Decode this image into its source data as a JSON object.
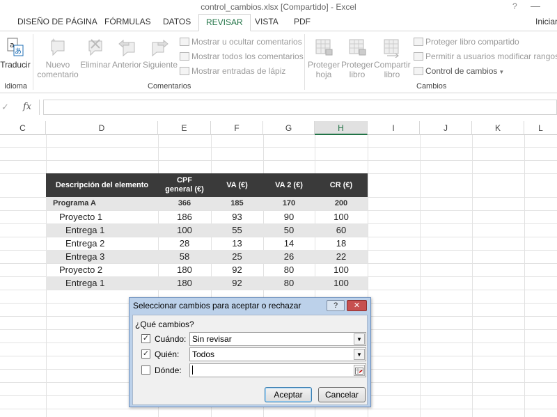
{
  "window": {
    "title": "control_cambios.xlsx  [Compartido] - Excel",
    "help": "?",
    "minimize": "—"
  },
  "tabs": [
    {
      "label": "DISEÑO DE PÁGINA"
    },
    {
      "label": "FÓRMULAS"
    },
    {
      "label": "DATOS"
    },
    {
      "label": "REVISAR",
      "active": true
    },
    {
      "label": "VISTA"
    },
    {
      "label": "PDF"
    }
  ],
  "signin": "Iniciar",
  "ribbon": {
    "translate": "Traducir",
    "new_comment": [
      "Nuevo",
      "comentario"
    ],
    "delete": "Eliminar",
    "previous": "Anterior",
    "next": "Siguiente",
    "show_hide_comment": "Mostrar u ocultar comentarios",
    "show_all_comments": "Mostrar todos los comentarios",
    "show_ink": "Mostrar entradas de lápiz",
    "protect_sheet": [
      "Proteger",
      "hoja"
    ],
    "protect_book": [
      "Proteger",
      "libro"
    ],
    "share_book": [
      "Compartir",
      "libro"
    ],
    "protect_shared": "Proteger libro compartido",
    "allow_users": "Permitir a usuarios modificar rangos",
    "track_changes": "Control de cambios",
    "groups": {
      "language": "Idioma",
      "comments": "Comentarios",
      "changes": "Cambios"
    }
  },
  "formula_bar": {
    "cancel": "✓",
    "fx": "fx",
    "value": ""
  },
  "columns": [
    "C",
    "D",
    "E",
    "F",
    "G",
    "H",
    "I",
    "J",
    "K",
    "L"
  ],
  "table": {
    "headers": [
      "Descripción del elemento",
      "CPF general (€)",
      "VA (€)",
      "VA 2 (€)",
      "CR (€)"
    ],
    "rows": [
      [
        "Programa A",
        "366",
        "185",
        "170",
        "200"
      ],
      [
        "Proyecto 1",
        "186",
        "93",
        "90",
        "100"
      ],
      [
        "Entrega 1",
        "100",
        "55",
        "50",
        "60"
      ],
      [
        "Entrega 2",
        "28",
        "13",
        "14",
        "18"
      ],
      [
        "Entrega 3",
        "58",
        "25",
        "26",
        "22"
      ],
      [
        "Proyecto 2",
        "180",
        "92",
        "80",
        "100"
      ],
      [
        "Entrega 1",
        "180",
        "92",
        "80",
        "100"
      ]
    ]
  },
  "dialog": {
    "title": "Seleccionar cambios para aceptar o rechazar",
    "help_btn": "?",
    "close_btn": "✕",
    "section": "¿Qué cambios?",
    "when_label": "Cuándo:",
    "when_value": "Sin revisar",
    "when_checked": true,
    "who_label": "Quién:",
    "who_value": "Todos",
    "who_checked": true,
    "where_label": "Dónde:",
    "where_value": "",
    "where_checked": false,
    "accept": "Aceptar",
    "cancel": "Cancelar"
  },
  "colors": {
    "accent": "#217346",
    "table_header": "#3a3a3a",
    "shade": "#e6e6e6",
    "dialog_frame": "#bcd1ea"
  }
}
